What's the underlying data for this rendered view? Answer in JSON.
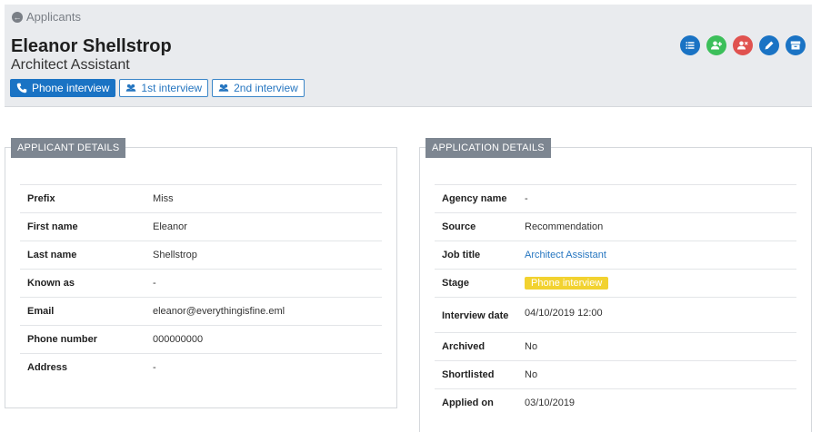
{
  "header": {
    "back_label": "Applicants",
    "applicant_name": "Eleanor Shellstrop",
    "job_title": "Architect Assistant",
    "stages": [
      {
        "label": "Phone interview",
        "icon": "phone-icon",
        "active": true
      },
      {
        "label": "1st interview",
        "icon": "group-icon",
        "active": false
      },
      {
        "label": "2nd interview",
        "icon": "group-icon",
        "active": false
      }
    ],
    "actions": [
      {
        "icon": "list-icon",
        "color": "#1a73c4"
      },
      {
        "icon": "add-user-icon",
        "color": "#3cbf5a"
      },
      {
        "icon": "remove-user-icon",
        "color": "#e0524f"
      },
      {
        "icon": "edit-icon",
        "color": "#1a73c4"
      },
      {
        "icon": "archive-icon",
        "color": "#1a73c4"
      }
    ]
  },
  "applicant_details": {
    "title": "APPLICANT DETAILS",
    "rows": [
      {
        "label": "Prefix",
        "value": "Miss"
      },
      {
        "label": "First name",
        "value": "Eleanor"
      },
      {
        "label": "Last name",
        "value": "Shellstrop"
      },
      {
        "label": "Known as",
        "value": "-"
      },
      {
        "label": "Email",
        "value": "eleanor@everythingisfine.eml"
      },
      {
        "label": "Phone number",
        "value": "000000000"
      },
      {
        "label": "Address",
        "value": "-"
      }
    ]
  },
  "application_details": {
    "title": "APPLICATION DETAILS",
    "agency_label": "Agency name",
    "agency_value": "-",
    "source_label": "Source",
    "source_value": "Recommendation",
    "job_label": "Job title",
    "job_value": "Architect Assistant",
    "stage_label": "Stage",
    "stage_value": "Phone interview",
    "stage_color": "#f2d230",
    "interview_label": "Interview date",
    "interview_value": "04/10/2019 12:00",
    "archived_label": "Archived",
    "archived_value": "No",
    "shortlisted_label": "Shortlisted",
    "shortlisted_value": "No",
    "applied_label": "Applied on",
    "applied_value": "03/10/2019"
  }
}
